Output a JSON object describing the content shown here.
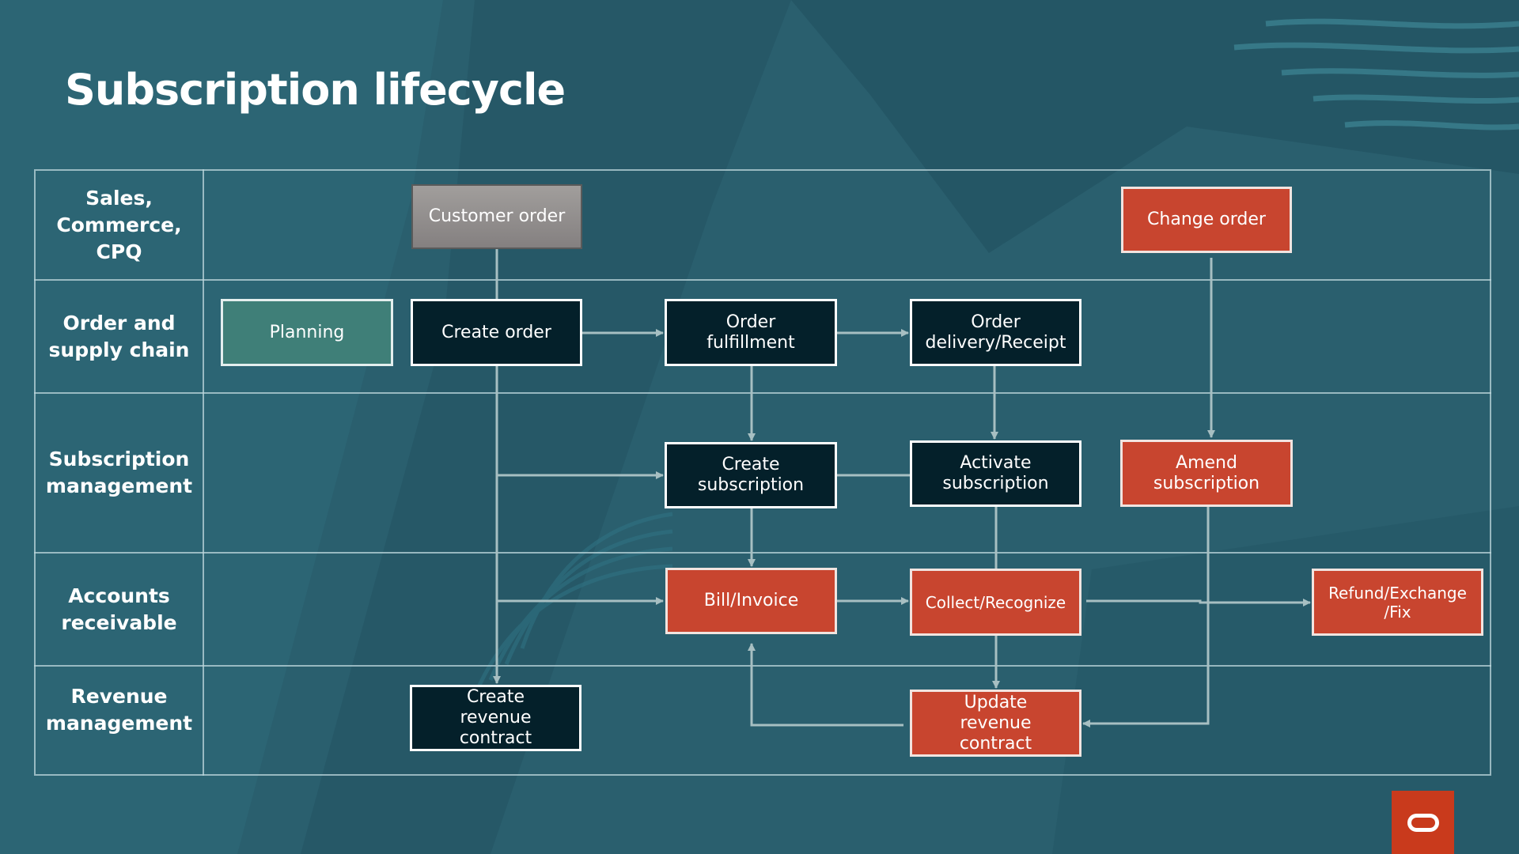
{
  "slide": {
    "title": "Subscription lifecycle",
    "colors": {
      "background": "#2a5f6e",
      "dark_box": "#04202a",
      "red_box": "#c8452f",
      "teal_box": "#3f7f78",
      "gray_box": "#94918f",
      "connector": "#a7bfc2",
      "logo": "#c93a1c"
    }
  },
  "lanes": [
    {
      "label": "Sales, Commerce, CPQ"
    },
    {
      "label": "Order and supply chain"
    },
    {
      "label": "Subscription management"
    },
    {
      "label": "Accounts receivable"
    },
    {
      "label": "Revenue management"
    }
  ],
  "nodes": {
    "customer_order": "Customer order",
    "change_order": "Change order",
    "planning": "Planning",
    "create_order": "Create order",
    "order_fulfillment": "Order fulfillment",
    "order_delivery": "Order delivery/Receipt",
    "create_subscription": "Create subscription",
    "activate_subscription": "Activate subscription",
    "amend_subscription": "Amend subscription",
    "bill_invoice": "Bill/Invoice",
    "collect_recognize": "Collect/Recognize",
    "refund_exchange": "Refund/Exchange /Fix",
    "create_revenue_contract": "Create revenue contract",
    "update_revenue_contract": "Update revenue contract"
  },
  "edges": [
    {
      "from": "customer_order",
      "to": "create_order"
    },
    {
      "from": "create_order",
      "to": "order_fulfillment"
    },
    {
      "from": "order_fulfillment",
      "to": "order_delivery"
    },
    {
      "from": "order_fulfillment",
      "to": "create_subscription"
    },
    {
      "from": "order_delivery",
      "to": "activate_subscription"
    },
    {
      "from": "create_order",
      "to": "create_subscription"
    },
    {
      "from": "create_order",
      "to": "bill_invoice"
    },
    {
      "from": "create_order",
      "to": "create_revenue_contract"
    },
    {
      "from": "create_subscription",
      "to": "activate_subscription"
    },
    {
      "from": "create_subscription",
      "to": "bill_invoice"
    },
    {
      "from": "activate_subscription",
      "to": "update_revenue_contract"
    },
    {
      "from": "bill_invoice",
      "to": "collect_recognize"
    },
    {
      "from": "collect_recognize",
      "to": "update_revenue_contract"
    },
    {
      "from": "collect_recognize",
      "to": "refund_exchange"
    },
    {
      "from": "change_order",
      "to": "amend_subscription"
    },
    {
      "from": "amend_subscription",
      "to": "update_revenue_contract"
    },
    {
      "from": "update_revenue_contract",
      "to": "bill_invoice"
    }
  ],
  "logo": {
    "icon": "oracle-logo-icon"
  }
}
